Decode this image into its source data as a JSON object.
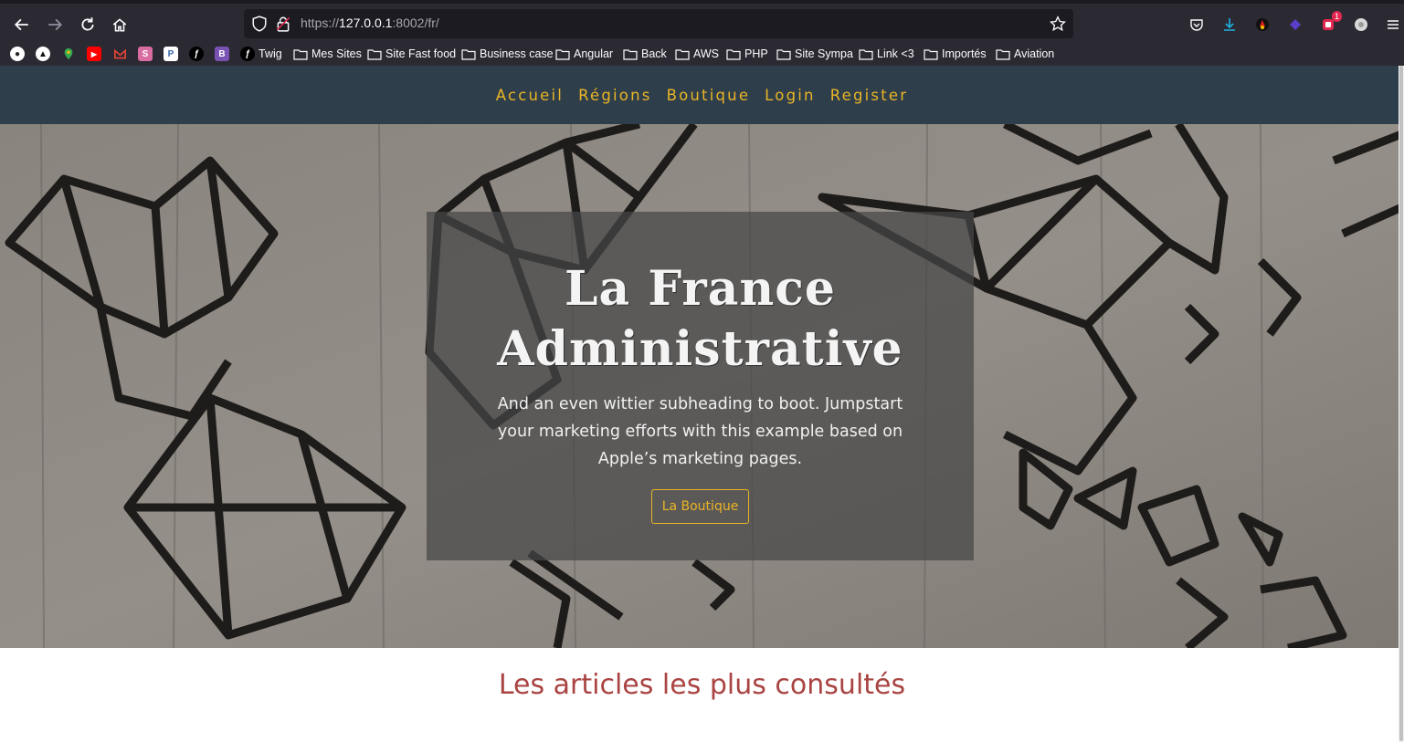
{
  "browser": {
    "url_prefix": "https://",
    "url_host": "127.0.0.1",
    "url_rest": ":8002/fr/",
    "extension_badge": "1",
    "bookmarks": [
      {
        "label": "",
        "icon": "github-icon"
      },
      {
        "label": "",
        "icon": "triangle-icon"
      },
      {
        "label": "",
        "icon": "maps-pin-icon"
      },
      {
        "label": "",
        "icon": "youtube-icon"
      },
      {
        "label": "",
        "icon": "gmail-icon"
      },
      {
        "label": "",
        "icon": "pink-app-icon"
      },
      {
        "label": "",
        "icon": "window-app-icon"
      },
      {
        "label": "",
        "icon": "symfony-icon"
      },
      {
        "label": "",
        "icon": "bootstrap-icon"
      },
      {
        "label": "Twig",
        "icon": "symfony-icon"
      },
      {
        "label": "Mes Sites",
        "icon": "folder-icon"
      },
      {
        "label": "Site Fast food",
        "icon": "folder-icon"
      },
      {
        "label": "Business case",
        "icon": "folder-icon"
      },
      {
        "label": "Angular",
        "icon": "folder-icon"
      },
      {
        "label": "Back",
        "icon": "folder-icon"
      },
      {
        "label": "AWS",
        "icon": "folder-icon"
      },
      {
        "label": "PHP",
        "icon": "folder-icon"
      },
      {
        "label": "Site Sympa",
        "icon": "folder-icon"
      },
      {
        "label": "Link <3",
        "icon": "folder-icon"
      },
      {
        "label": "Importés",
        "icon": "folder-icon"
      },
      {
        "label": "Aviation",
        "icon": "folder-icon"
      }
    ]
  },
  "nav": {
    "items": [
      "Accueil",
      "Régions",
      "Boutique",
      "Login",
      "Register"
    ]
  },
  "hero": {
    "title_line1": "La France",
    "title_line2": "Administrative",
    "subtitle": "And an even wittier subheading to boot. Jumpstart your marketing efforts with this example based on Apple’s marketing pages.",
    "button_label": "La Boutique"
  },
  "section": {
    "title": "Les articles les plus consultés"
  },
  "colors": {
    "nav_bg": "#2f3e4b",
    "accent": "#e9b525",
    "section_title": "#a94442",
    "chrome_bg": "#2b2a33"
  }
}
